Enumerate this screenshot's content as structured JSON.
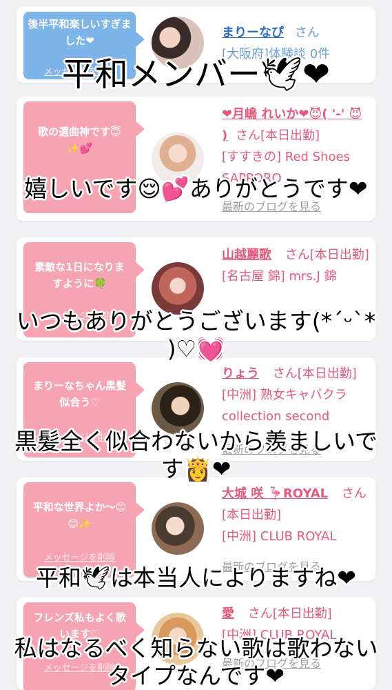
{
  "cards": [
    {
      "bubble": "後半平和楽しいすぎました❤",
      "bubble_color": "blue",
      "delete_label": "メッセージを削除",
      "name": "まりーなぴ",
      "san": "さん",
      "line2": "[大阪府]体験談 0件",
      "blog": ""
    },
    {
      "bubble": "歌の選曲神です😇✨💕",
      "bubble_color": "pink",
      "delete_label": "",
      "name": "❤月嶋 れいか❤😈( '-' 😈 )",
      "san": "さん[本日出勤]",
      "line2": "[すすきの] Red Shoes SAPPORO",
      "blog": "最新のブログを見る"
    },
    {
      "bubble": "素敵な1日になりますように🍀",
      "bubble_color": "pink",
      "delete_label": "メッセージを削除",
      "name": "山越麗歌",
      "san": "さん[本日出勤]",
      "line2": "[名古屋 錦] mrs.J 錦",
      "blog": ""
    },
    {
      "bubble": "まりーなちゃん黒髪似合う♡",
      "bubble_color": "pink",
      "delete_label": "メッセージを削除",
      "name": "りょう",
      "san": "さん[本日出勤]",
      "line2": "[中洲] 熟女キャバクラ collection second",
      "blog": "最新のブログを見る"
    },
    {
      "bubble": "平和な世界よか〜😊😊✨",
      "bubble_color": "pink",
      "delete_label": "メッセージを削除",
      "name": "大城 咲 🦩ROYAL",
      "san": "さん[本日出勤]",
      "line2": "[中洲] CLUB ROYAL",
      "blog": "最新のブログを見る"
    },
    {
      "bubble": "フレンズ私もよく歌います♡",
      "bubble_color": "pink",
      "delete_label": "メッセージを削除",
      "name": "愛",
      "san": "さん[本日出勤]",
      "line2": "[中洲] CLUB ROYAL",
      "blog": "最新のブログを見る"
    }
  ],
  "captions": [
    "平和メンバー🕊❤",
    "嬉しいです😌💕ありがとうです❤",
    "いつもありがとうございます(*ˊᵕˋ* )♡💓",
    "黒髪全く似合わないから羨ましいです👸❤",
    "平和🕊は本当人によりますね❤",
    "私はなるべく知らない歌は歌わないタイプなんです❤"
  ],
  "colors": {
    "accent_pink": "#e55a7a",
    "bubble_pink": "#f6a4b2",
    "bubble_blue": "#7db4ea",
    "name_blue": "#2b6bcb"
  }
}
